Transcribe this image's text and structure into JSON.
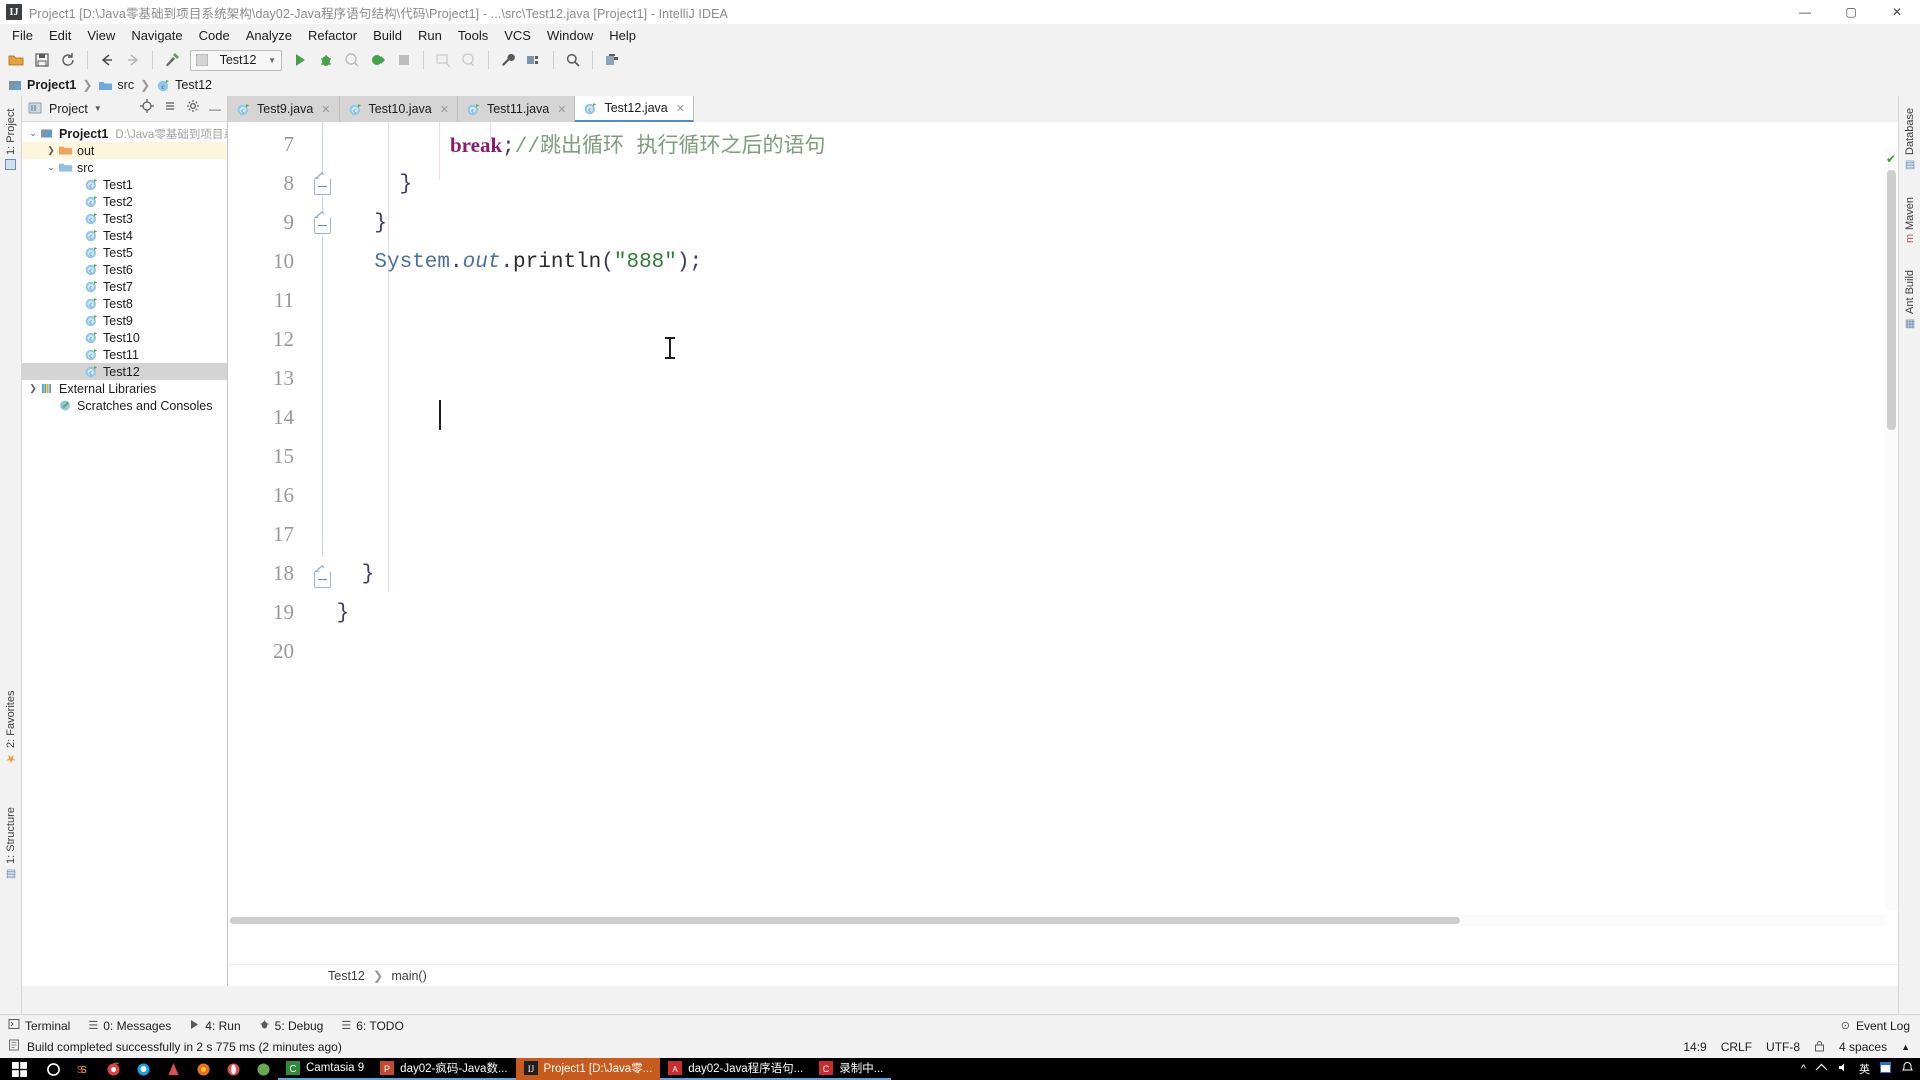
{
  "window": {
    "title": "Project1 [D:\\Java零基础到项目系统架构\\day02-Java程序语句结构\\代码\\Project1] - ...\\src\\Test12.java [Project1] - IntelliJ IDEA",
    "logo": "IJ",
    "minimize": "—",
    "maximize": "▢",
    "close": "✕"
  },
  "menu": [
    "File",
    "Edit",
    "View",
    "Navigate",
    "Code",
    "Analyze",
    "Refactor",
    "Build",
    "Run",
    "Tools",
    "VCS",
    "Window",
    "Help"
  ],
  "toolbar": {
    "run_config": "Test12",
    "icons": [
      "open-folder-icon",
      "save-all-icon",
      "sync-icon",
      "back-icon",
      "forward-icon",
      "build-hammer-icon",
      "run-icon",
      "debug-icon",
      "run-coverage-icon",
      "run-profile-icon",
      "stop-icon",
      "attach-icon",
      "update-icon",
      "settings-wrench-icon",
      "project-structure-icon",
      "search-everywhere-icon",
      "commit-icon"
    ]
  },
  "breadcrumb": {
    "project": "Project1",
    "folder": "src",
    "file": "Test12"
  },
  "project_panel": {
    "header_title": "Project",
    "tree": [
      {
        "label": "Project1",
        "sub": "D:\\Java零基础到项目系统架构",
        "icon": "project-icon",
        "twisty": "v",
        "indent": 1,
        "bold": true,
        "highlight": "none"
      },
      {
        "label": "out",
        "sub": "",
        "icon": "folder-orange-icon",
        "twisty": ">",
        "indent": 2,
        "bold": false,
        "highlight": "yellow"
      },
      {
        "label": "src",
        "sub": "",
        "icon": "folder-blue-icon",
        "twisty": "v",
        "indent": 2,
        "bold": false,
        "highlight": "none"
      },
      {
        "label": "Test1",
        "sub": "",
        "icon": "java-class-icon",
        "twisty": "",
        "indent": 3,
        "bold": false,
        "highlight": "none"
      },
      {
        "label": "Test2",
        "sub": "",
        "icon": "java-class-icon",
        "twisty": "",
        "indent": 3,
        "bold": false,
        "highlight": "none"
      },
      {
        "label": "Test3",
        "sub": "",
        "icon": "java-class-icon",
        "twisty": "",
        "indent": 3,
        "bold": false,
        "highlight": "none"
      },
      {
        "label": "Test4",
        "sub": "",
        "icon": "java-class-icon",
        "twisty": "",
        "indent": 3,
        "bold": false,
        "highlight": "none"
      },
      {
        "label": "Test5",
        "sub": "",
        "icon": "java-class-icon",
        "twisty": "",
        "indent": 3,
        "bold": false,
        "highlight": "none"
      },
      {
        "label": "Test6",
        "sub": "",
        "icon": "java-class-icon",
        "twisty": "",
        "indent": 3,
        "bold": false,
        "highlight": "none"
      },
      {
        "label": "Test7",
        "sub": "",
        "icon": "java-class-icon",
        "twisty": "",
        "indent": 3,
        "bold": false,
        "highlight": "none"
      },
      {
        "label": "Test8",
        "sub": "",
        "icon": "java-class-icon",
        "twisty": "",
        "indent": 3,
        "bold": false,
        "highlight": "none"
      },
      {
        "label": "Test9",
        "sub": "",
        "icon": "java-class-icon",
        "twisty": "",
        "indent": 3,
        "bold": false,
        "highlight": "none"
      },
      {
        "label": "Test10",
        "sub": "",
        "icon": "java-class-icon",
        "twisty": "",
        "indent": 3,
        "bold": false,
        "highlight": "none"
      },
      {
        "label": "Test11",
        "sub": "",
        "icon": "java-class-icon",
        "twisty": "",
        "indent": 3,
        "bold": false,
        "highlight": "none"
      },
      {
        "label": "Test12",
        "sub": "",
        "icon": "java-class-icon",
        "twisty": "",
        "indent": 3,
        "bold": false,
        "highlight": "selected"
      },
      {
        "label": "External Libraries",
        "sub": "",
        "icon": "libraries-icon",
        "twisty": ">",
        "indent": 1,
        "bold": false,
        "highlight": "none"
      },
      {
        "label": "Scratches and Consoles",
        "sub": "",
        "icon": "scratches-icon",
        "twisty": "",
        "indent": 2,
        "bold": false,
        "highlight": "none"
      }
    ]
  },
  "left_rail": [
    {
      "label": "1: Project",
      "icon": "project-tool-icon"
    },
    {
      "label": "2: Favorites",
      "icon": "favorites-star-icon"
    },
    {
      "label": "1: Structure",
      "icon": "structure-icon"
    }
  ],
  "right_rail": [
    {
      "label": "Database",
      "icon": "database-icon"
    },
    {
      "label": "Maven",
      "icon": "maven-icon"
    },
    {
      "label": "Ant Build",
      "icon": "ant-icon"
    }
  ],
  "editor": {
    "tabs": [
      {
        "label": "Test9.java",
        "active": false
      },
      {
        "label": "Test10.java",
        "active": false
      },
      {
        "label": "Test11.java",
        "active": false
      },
      {
        "label": "Test12.java",
        "active": true
      }
    ],
    "line_numbers": [
      "7",
      "8",
      "9",
      "10",
      "11",
      "12",
      "13",
      "14",
      "15",
      "16",
      "17",
      "18",
      "19",
      "20"
    ],
    "lines": [
      {
        "num": "7",
        "indent": 10,
        "tokens": [
          {
            "t": "break",
            "c": "kw"
          },
          {
            "t": ";",
            "c": "punct"
          },
          {
            "t": "//跳出循环 执行循环之后的语句",
            "c": "cmt"
          }
        ]
      },
      {
        "num": "8",
        "indent": 6,
        "tokens": [
          {
            "t": "}",
            "c": "punct"
          }
        ]
      },
      {
        "num": "9",
        "indent": 4,
        "tokens": [
          {
            "t": "}",
            "c": "punct"
          }
        ]
      },
      {
        "num": "10",
        "indent": 4,
        "tokens": [
          {
            "t": "System",
            "c": "cls"
          },
          {
            "t": ".",
            "c": "punct"
          },
          {
            "t": "out",
            "c": "fld"
          },
          {
            "t": ".",
            "c": "punct"
          },
          {
            "t": "println",
            "c": "mth"
          },
          {
            "t": "(",
            "c": "punct"
          },
          {
            "t": "\"888\"",
            "c": "str"
          },
          {
            "t": ")",
            "c": "punct"
          },
          {
            "t": ";",
            "c": "punct"
          }
        ]
      },
      {
        "num": "11",
        "indent": 0,
        "tokens": []
      },
      {
        "num": "12",
        "indent": 0,
        "tokens": []
      },
      {
        "num": "13",
        "indent": 0,
        "tokens": []
      },
      {
        "num": "14",
        "indent": 0,
        "tokens": []
      },
      {
        "num": "15",
        "indent": 0,
        "tokens": []
      },
      {
        "num": "16",
        "indent": 0,
        "tokens": []
      },
      {
        "num": "17",
        "indent": 0,
        "tokens": []
      },
      {
        "num": "18",
        "indent": 3,
        "tokens": [
          {
            "t": "}",
            "c": "punct"
          }
        ]
      },
      {
        "num": "19",
        "indent": 1,
        "tokens": [
          {
            "t": "}",
            "c": "punct"
          }
        ]
      },
      {
        "num": "20",
        "indent": 0,
        "tokens": []
      }
    ],
    "status_breadcrumb": {
      "class": "Test12",
      "member": "main()"
    }
  },
  "tool_windows": [
    {
      "label": "Terminal",
      "icon": "terminal-icon"
    },
    {
      "label": "0: Messages",
      "icon": "messages-icon"
    },
    {
      "label": "4: Run",
      "icon": "run-icon"
    },
    {
      "label": "5: Debug",
      "icon": "debug-icon"
    },
    {
      "label": "6: TODO",
      "icon": "todo-icon"
    }
  ],
  "event_log": "Event Log",
  "status": {
    "message": "Build completed successfully in 2 s 775 ms (2 minutes ago)",
    "caret_position": "14:9",
    "line_separator": "CRLF",
    "encoding": "UTF-8",
    "indent": "4 spaces",
    "lock_icon": "lock-icon"
  },
  "taskbar": {
    "start": "start-icon",
    "quick_launch": [
      "cortana-icon",
      "task-view-icon",
      "chrome-icon",
      "qq-icon",
      "app-red-icon",
      "firefox-icon",
      "opera-icon",
      "app-green-icon"
    ],
    "tasks": [
      {
        "label": "Camtasia 9",
        "icon": "camtasia-icon",
        "state": "open"
      },
      {
        "label": "day02-疯码-Java数...",
        "icon": "powerpoint-icon",
        "state": "open"
      },
      {
        "label": "Project1 [D:\\Java零...",
        "icon": "intellij-icon",
        "state": "active"
      },
      {
        "label": "day02-Java程序语句...",
        "icon": "pdf-icon",
        "state": "open"
      },
      {
        "label": "录制中...",
        "icon": "camtasia-rec-icon",
        "state": "open"
      }
    ],
    "tray": {
      "chevron": "^",
      "ime": "英",
      "time": "",
      "date": ""
    }
  }
}
